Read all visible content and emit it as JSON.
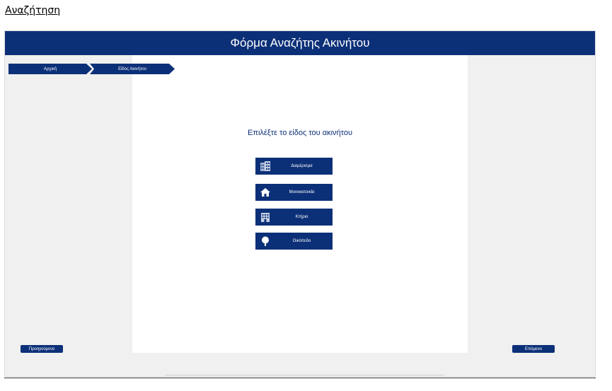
{
  "page_link": "Αναζήτηση",
  "header": {
    "title": "Φόρμα Αναζήτης Ακινήτου"
  },
  "breadcrumb": {
    "items": [
      {
        "label": "Αρχική"
      },
      {
        "label": "Είδος Ακινήτου"
      }
    ]
  },
  "main": {
    "prompt": "Επιλέξτε το είδος του ακινήτου",
    "types": [
      {
        "label": "Διαμέρισμα",
        "icon": "building-icon"
      },
      {
        "label": "Μονοκατοικία",
        "icon": "house-icon"
      },
      {
        "label": "Κτήριο",
        "icon": "office-building-icon"
      },
      {
        "label": "Οικόπεδο",
        "icon": "tree-icon"
      }
    ]
  },
  "nav": {
    "previous_label": "Προηγούμενο",
    "next_label": "Επόμενο"
  },
  "colors": {
    "primary": "#0c3078",
    "background": "#f0f0f0",
    "panel": "#ffffff"
  }
}
